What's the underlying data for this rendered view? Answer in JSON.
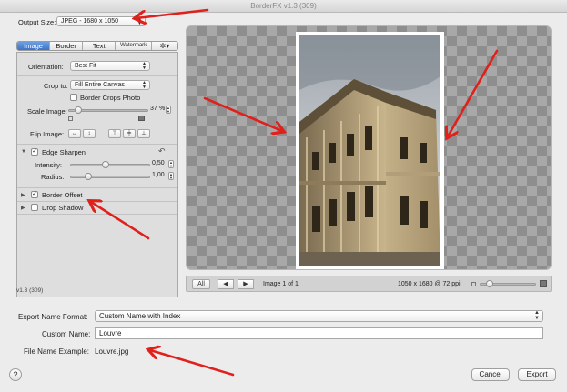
{
  "window": {
    "title": "BorderFX v1.3 (309)"
  },
  "output": {
    "label": "Output Size:",
    "value": "JPEG - 1680 x 1050"
  },
  "tabs": [
    {
      "label": "Image",
      "active": true
    },
    {
      "label": "Border"
    },
    {
      "label": "Text"
    },
    {
      "label": "Watermark"
    },
    {
      "icon": "gear-icon",
      "glyph": "✲▾"
    }
  ],
  "image_panel": {
    "orientation_label": "Orientation:",
    "orientation_value": "Best Fit",
    "crop_label": "Crop to:",
    "crop_value": "Fill Entire Canvas",
    "border_crops_label": "Border Crops Photo",
    "scale_label": "Scale Image:",
    "scale_value": "37",
    "scale_unit": "%",
    "scale_fraction": 0.08,
    "flip_label": "Flip Image:"
  },
  "edge_sharpen": {
    "label": "Edge Sharpen",
    "checked": true,
    "intensity_label": "Intensity:",
    "intensity_value": "0,50",
    "radius_label": "Radius:",
    "radius_value": "1,00"
  },
  "border_offset": {
    "label": "Border Offset",
    "checked": true
  },
  "drop_shadow": {
    "label": "Drop Shadow",
    "checked": false
  },
  "version_label": "v1.3 (309)",
  "preview": {
    "all_button": "All",
    "prev_glyph": "◀",
    "next_glyph": "▶",
    "image_counter": "Image 1 of 1",
    "image_info": "1050 x 1680 @ 72 ppi",
    "zoom_fraction": 0.12
  },
  "export": {
    "format_label": "Export Name Format:",
    "format_value": "Custom Name with Index",
    "custom_label": "Custom Name:",
    "custom_value": "Louvre",
    "example_label": "File Name Example:",
    "example_value": "Louvre.jpg"
  },
  "footer": {
    "help": "?",
    "cancel": "Cancel",
    "export": "Export"
  },
  "colors": {
    "annotation_arrow": "#e0201a",
    "accent": "#3d74c8"
  }
}
